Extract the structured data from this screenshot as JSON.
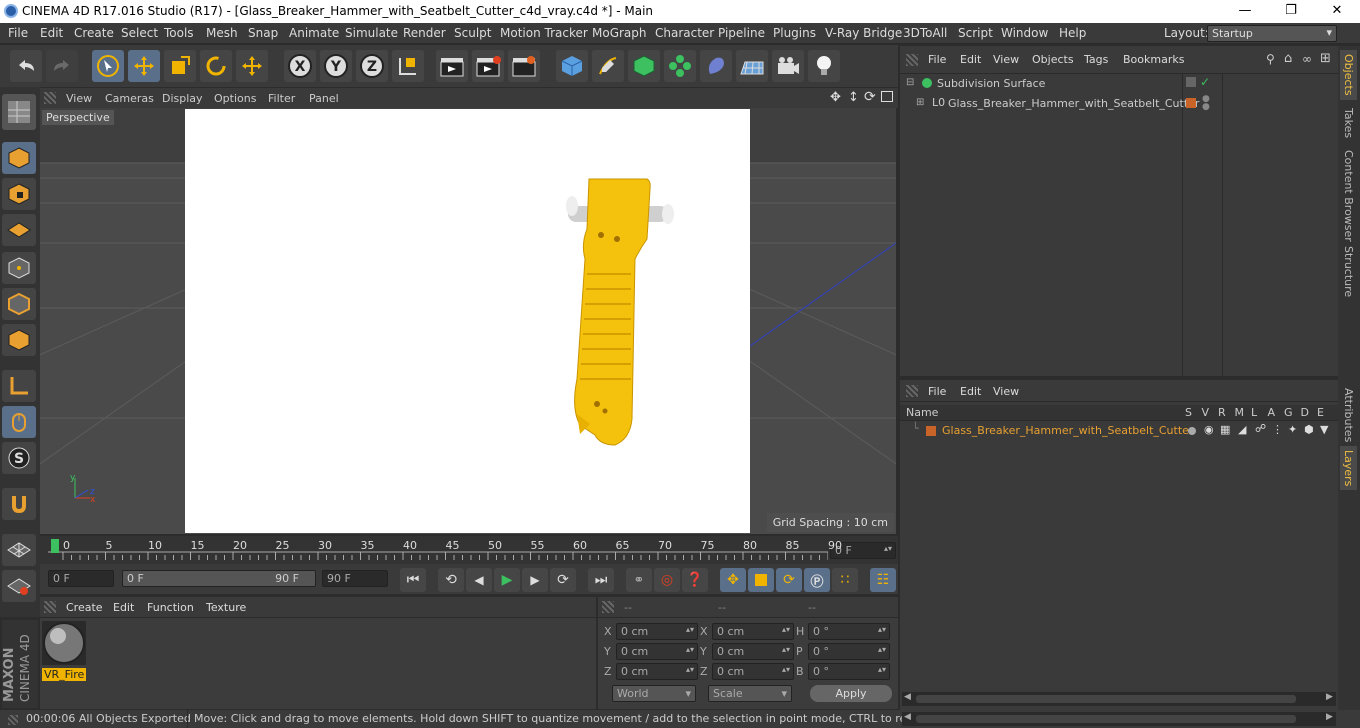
{
  "title_bar": {
    "text": "CINEMA 4D R17.016 Studio (R17) - [Glass_Breaker_Hammer_with_Seatbelt_Cutter_c4d_vray.c4d *] - Main"
  },
  "menu": [
    "File",
    "Edit",
    "Create",
    "Select",
    "Tools",
    "Mesh",
    "Snap",
    "Animate",
    "Simulate",
    "Render",
    "Sculpt",
    "Motion Tracker",
    "MoGraph",
    "Character",
    "Pipeline",
    "Plugins",
    "V-Ray Bridge",
    "3DToAll",
    "Script",
    "Window",
    "Help"
  ],
  "layout": {
    "label": "Layout:",
    "value": "Startup"
  },
  "viewport_menu": [
    "View",
    "Cameras",
    "Display",
    "Options",
    "Filter",
    "Panel"
  ],
  "viewport": {
    "label": "Perspective",
    "grid_spacing": "Grid Spacing : 10 cm"
  },
  "timeline": {
    "ticks": [
      "0",
      "5",
      "10",
      "15",
      "20",
      "25",
      "30",
      "35",
      "40",
      "45",
      "50",
      "55",
      "60",
      "65",
      "70",
      "75",
      "80",
      "85",
      "90"
    ],
    "frame_field": "0 F"
  },
  "playback": {
    "start": "0 F",
    "range_start": "0 F",
    "range_end": "90 F",
    "end": "90 F"
  },
  "material_menu": [
    "Create",
    "Edit",
    "Function",
    "Texture"
  ],
  "material": {
    "name": "VR_Fire"
  },
  "coords": {
    "headers": [
      "--",
      "--",
      "--"
    ],
    "rows": [
      {
        "a": "X",
        "av": "0 cm",
        "b": "X",
        "bv": "0 cm",
        "c": "H",
        "cv": "0 °"
      },
      {
        "a": "Y",
        "av": "0 cm",
        "b": "Y",
        "bv": "0 cm",
        "c": "P",
        "cv": "0 °"
      },
      {
        "a": "Z",
        "av": "0 cm",
        "b": "Z",
        "bv": "0 cm",
        "c": "B",
        "cv": "0 °"
      }
    ],
    "world": "World",
    "scale": "Scale",
    "apply": "Apply"
  },
  "objects_menu": [
    "File",
    "Edit",
    "View",
    "Objects",
    "Tags",
    "Bookmarks"
  ],
  "objects": [
    {
      "name": "Subdivision Surface"
    },
    {
      "name": "Glass_Breaker_Hammer_with_Seatbelt_Cutter"
    }
  ],
  "layers_menu": [
    "File",
    "Edit",
    "View"
  ],
  "layers_header": {
    "name": "Name",
    "cols": [
      "S",
      "V",
      "R",
      "M",
      "L",
      "A",
      "G",
      "D",
      "E"
    ]
  },
  "layers": [
    {
      "name": "Glass_Breaker_Hammer_with_Seatbelt_Cutter"
    }
  ],
  "right_tabs": [
    "Objects",
    "Takes",
    "Content Browser",
    "Structure",
    "Attributes",
    "Layers"
  ],
  "status": {
    "time": "00:00:06 All Objects Exported",
    "message": "Move: Click and drag to move elements. Hold down SHIFT to quantize movement / add to the selection in point mode, CTRL to remove."
  },
  "brand": {
    "maxon": "MAXON",
    "cinema": "CINEMA 4D"
  },
  "colors": {
    "accent": "#f0b400",
    "object_orange": "#e8a030",
    "layer_swatch": "#c86428",
    "select_blue": "#5a6f8a"
  }
}
